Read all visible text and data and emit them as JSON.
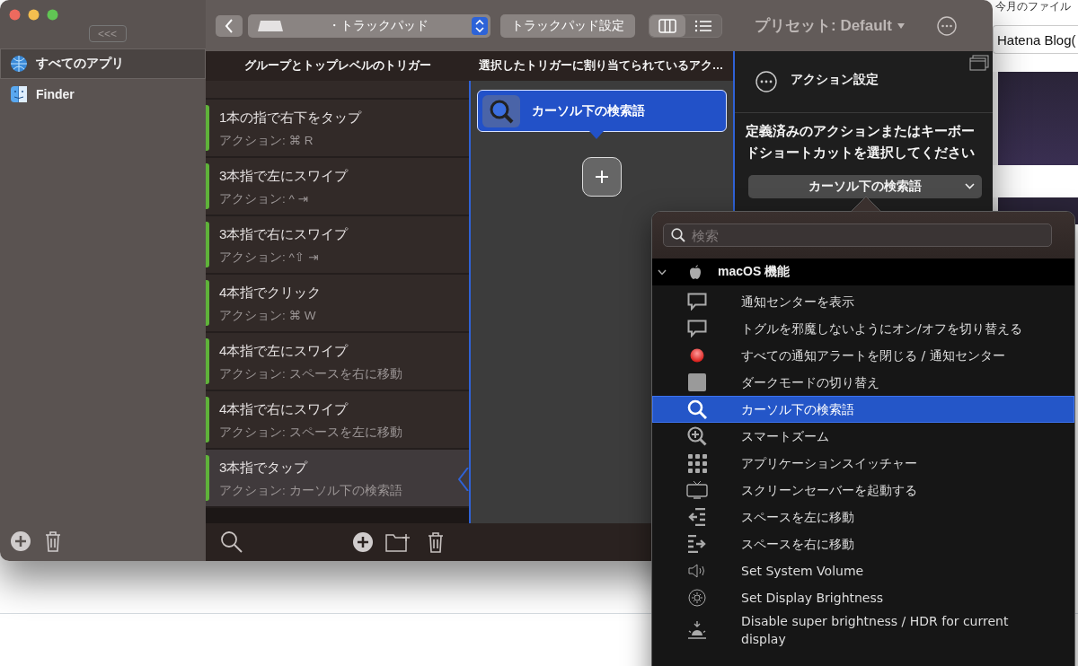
{
  "web_page": {
    "heading": "今月のファイル",
    "field_value": "Hatena Blog("
  },
  "window": {
    "sidebar": {
      "collapse_button": "<<<",
      "items": [
        {
          "label": "すべてのアプリ",
          "kind": "globe",
          "selected": true
        },
        {
          "label": "Finder",
          "kind": "finder",
          "selected": false
        }
      ]
    },
    "toolbar": {
      "device_selector": "・トラックパッド",
      "settings_button": "トラックパッド設定",
      "view_modes": [
        {
          "kind": "columns",
          "selected": true
        },
        {
          "kind": "list",
          "selected": false
        }
      ],
      "preset": "プリセット: Default"
    },
    "triggers": {
      "header": "グループとトップレベルのトリガー",
      "items": [
        {
          "title": "1本の指で右下をタップ",
          "action": "アクション: ⌘ R",
          "enabled": true,
          "selected": false
        },
        {
          "title": "3本指で左にスワイプ",
          "action": "アクション: ^ ⇥",
          "enabled": true,
          "selected": false
        },
        {
          "title": "3本指で右にスワイプ",
          "action": "アクション: ^⇧ ⇥",
          "enabled": true,
          "selected": false
        },
        {
          "title": "4本指でクリック",
          "action": "アクション: ⌘ W",
          "enabled": true,
          "selected": false
        },
        {
          "title": "4本指で左にスワイプ",
          "action": "アクション: スペースを右に移動",
          "enabled": true,
          "selected": false
        },
        {
          "title": "4本指で右にスワイプ",
          "action": "アクション: スペースを左に移動",
          "enabled": true,
          "selected": false
        },
        {
          "title": "3本指でタップ",
          "action": "アクション: カーソル下の検索語",
          "enabled": true,
          "selected": true
        }
      ]
    },
    "actions": {
      "header": "選択したトリガーに割り当てられているアク…",
      "items": [
        {
          "label": "カーソル下の検索語",
          "selected": true
        }
      ]
    },
    "settings": {
      "title": "アクション設定",
      "prompt": "定義済みのアクションまたはキーボードショートカットを選択してください",
      "dropdown": "カーソル下の検索語"
    }
  },
  "popup": {
    "search_placeholder": "検索",
    "group": {
      "label": "macOS 機能",
      "expanded": true,
      "children": [
        {
          "label": "通知センターを表示",
          "kind": "bubble",
          "selected": false
        },
        {
          "label": "トグルを邪魔しないようにオン/オフを切り替える",
          "kind": "bubble",
          "selected": false
        },
        {
          "label": "すべての通知アラートを閉じる / 通知センター",
          "kind": "dot",
          "selected": false
        },
        {
          "label": "ダークモードの切り替え",
          "kind": "square",
          "selected": false
        },
        {
          "label": "カーソル下の検索語",
          "kind": "search",
          "selected": true
        },
        {
          "label": "スマートズーム",
          "kind": "zoom",
          "selected": false
        },
        {
          "label": "アプリケーションスイッチャー",
          "kind": "grid",
          "selected": false
        },
        {
          "label": "スクリーンセーバーを起動する",
          "kind": "tv",
          "selected": false
        },
        {
          "label": "スペースを左に移動",
          "kind": "space-left",
          "selected": false
        },
        {
          "label": "スペースを右に移動",
          "kind": "space-right",
          "selected": false
        },
        {
          "label": "Set System Volume",
          "kind": "speaker",
          "selected": false
        },
        {
          "label": "Set Display Brightness",
          "kind": "brightness",
          "selected": false
        },
        {
          "label": "Disable super brightness / HDR for current display",
          "kind": "sunset",
          "selected": false
        }
      ]
    }
  }
}
